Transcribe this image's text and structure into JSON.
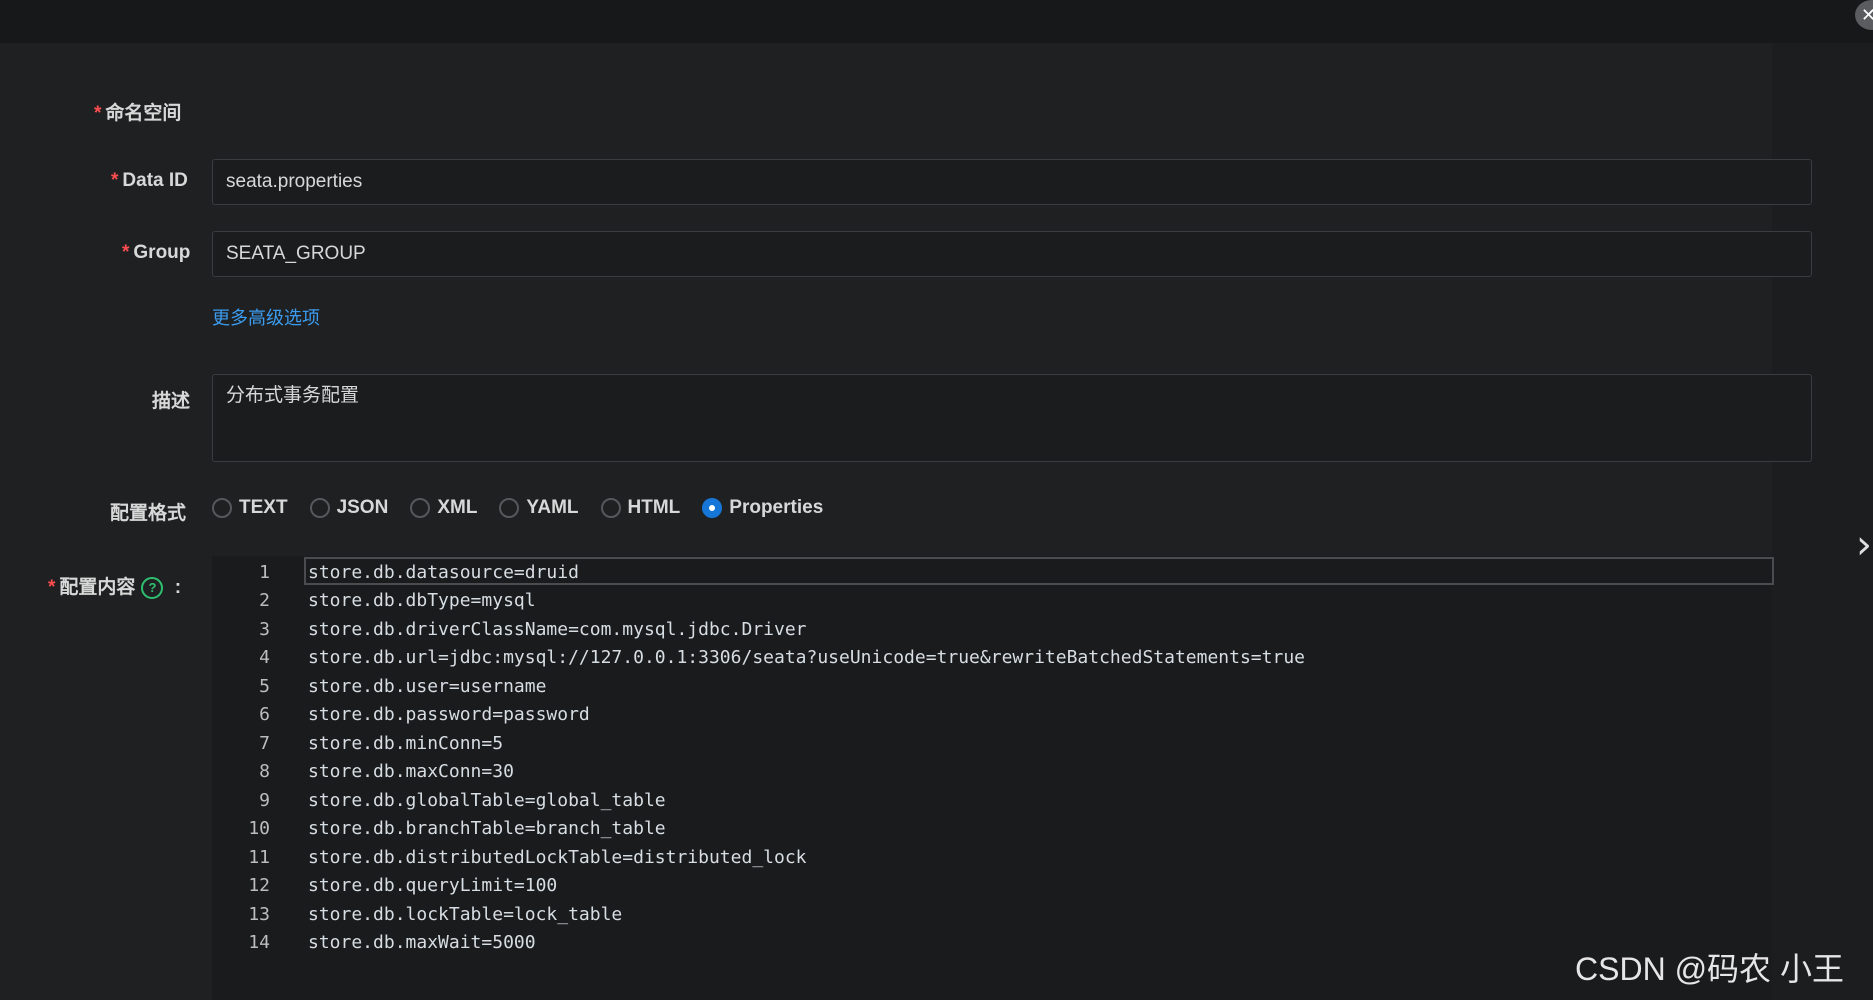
{
  "form": {
    "namespace_label": "命名空间",
    "data_id_label": "Data ID",
    "data_id_value": "seata.properties",
    "group_label": "Group",
    "group_value": "SEATA_GROUP",
    "advanced_link": "更多高级选项",
    "description_label": "描述",
    "description_value": "分布式事务配置",
    "format_label": "配置格式",
    "formats": [
      "TEXT",
      "JSON",
      "XML",
      "YAML",
      "HTML",
      "Properties"
    ],
    "selected_format": "Properties",
    "content_label": "配置内容",
    "content_suffix": ":",
    "required_mark": "*"
  },
  "editor": {
    "lines": [
      {
        "no": "1",
        "text": "store.db.datasource=druid"
      },
      {
        "no": "2",
        "text": "store.db.dbType=mysql"
      },
      {
        "no": "3",
        "text": "store.db.driverClassName=com.mysql.jdbc.Driver"
      },
      {
        "no": "4",
        "text": "store.db.url=jdbc:mysql://127.0.0.1:3306/seata?useUnicode=true&rewriteBatchedStatements=true"
      },
      {
        "no": "5",
        "text": "store.db.user=username"
      },
      {
        "no": "6",
        "text": "store.db.password=password"
      },
      {
        "no": "7",
        "text": "store.db.minConn=5"
      },
      {
        "no": "8",
        "text": "store.db.maxConn=30"
      },
      {
        "no": "9",
        "text": "store.db.globalTable=global_table"
      },
      {
        "no": "10",
        "text": "store.db.branchTable=branch_table"
      },
      {
        "no": "11",
        "text": "store.db.distributedLockTable=distributed_lock"
      },
      {
        "no": "12",
        "text": "store.db.queryLimit=100"
      },
      {
        "no": "13",
        "text": "store.db.lockTable=lock_table"
      },
      {
        "no": "14",
        "text": "store.db.maxWait=5000"
      }
    ]
  },
  "icons": {
    "close": "close-icon",
    "next": "chevron-right-icon",
    "help": "help-circle-icon"
  },
  "colors": {
    "accent": "#1677d8",
    "link": "#3b9cf0",
    "required": "#ff4d4f",
    "help": "#2fbf71"
  },
  "watermark": "CSDN @码农 小王"
}
